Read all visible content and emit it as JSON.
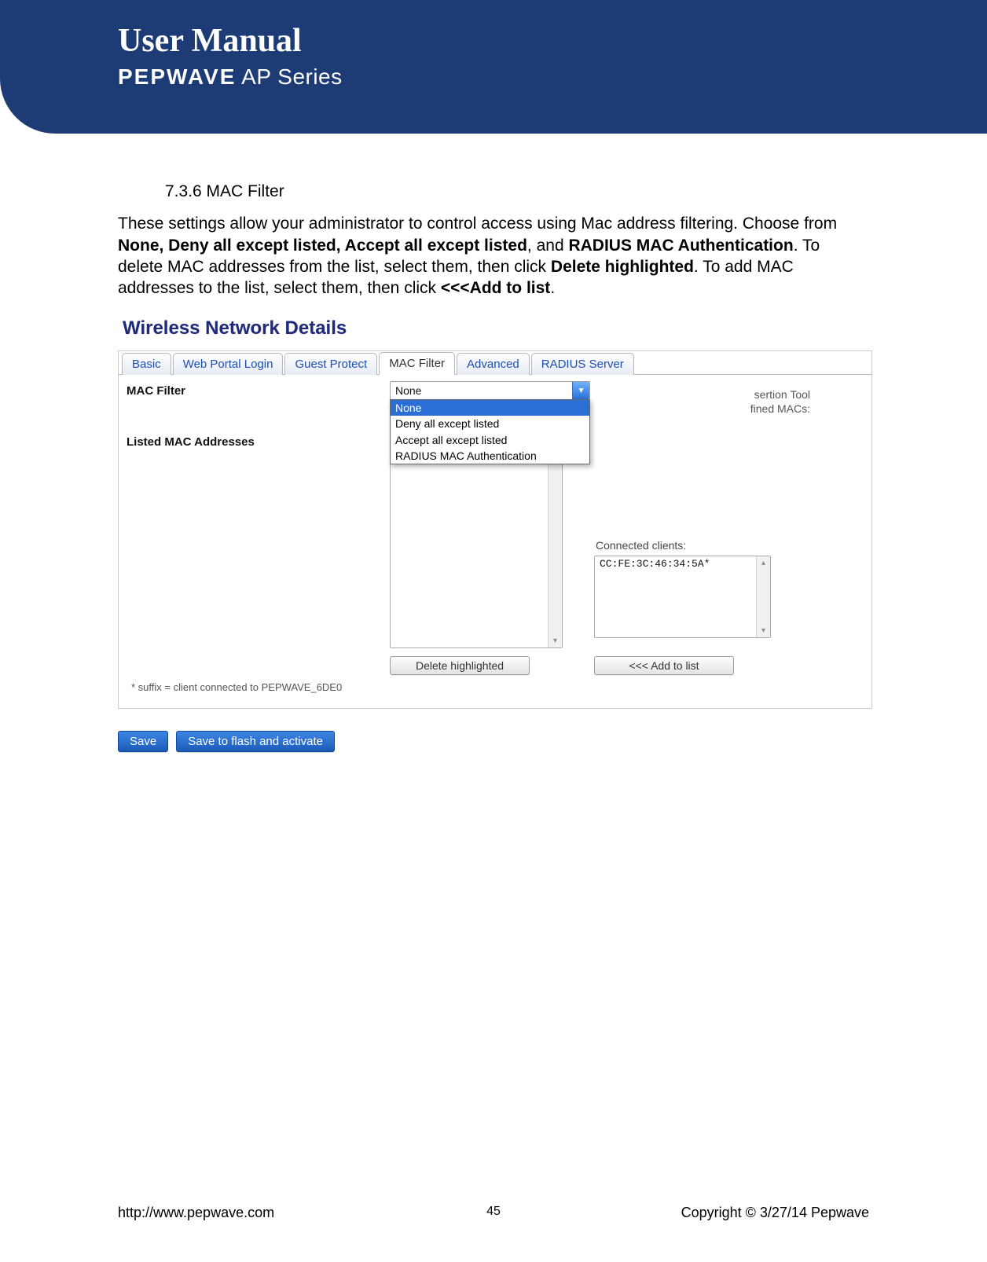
{
  "header": {
    "title": "User Manual",
    "brand": "PEPWAVE",
    "series": "AP Series"
  },
  "section": {
    "number": "7.3.6 MAC Filter"
  },
  "paragraph": {
    "p1a": "These settings allow your administrator to control access using Mac address filtering. Choose from ",
    "p1b_bold": "None, Deny all except listed, Accept all except listed",
    "p1c": ", and ",
    "p1d_bold": "RADIUS MAC Authentication",
    "p1e": ". To delete MAC addresses from the list, select them, then click ",
    "p1f_bold": "Delete highlighted",
    "p1g": ". To add MAC addresses to the list, select them, then click ",
    "p1h_bold": "<<<Add to list",
    "p1i": "."
  },
  "screenshot": {
    "title": "Wireless Network Details",
    "tabs": [
      "Basic",
      "Web Portal Login",
      "Guest Protect",
      "MAC Filter",
      "Advanced",
      "RADIUS Server"
    ],
    "active_tab": "MAC Filter",
    "labels": {
      "mac_filter": "MAC Filter",
      "listed_mac": "Listed MAC Addresses"
    },
    "dropdown": {
      "current": "None",
      "options": [
        "None",
        "Deny all except listed",
        "Accept all except listed",
        "RADIUS MAC Authentication"
      ],
      "selected": "None"
    },
    "insertion_tool_legend_partial": "sertion Tool",
    "defined_macs_partial": "fined MACs:",
    "connected_clients_label": "Connected clients:",
    "connected_client_value": "CC:FE:3C:46:34:5A*",
    "delete_btn": "Delete highlighted",
    "add_btn": "<<< Add to list",
    "suffix_note": "*  suffix = client connected to PEPWAVE_6DE0",
    "save_btn": "Save",
    "save_flash_btn": "Save to flash and activate"
  },
  "footer": {
    "url": "http://www.pepwave.com",
    "page": "45",
    "copyright": "Copyright © 3/27/14 Pepwave"
  }
}
